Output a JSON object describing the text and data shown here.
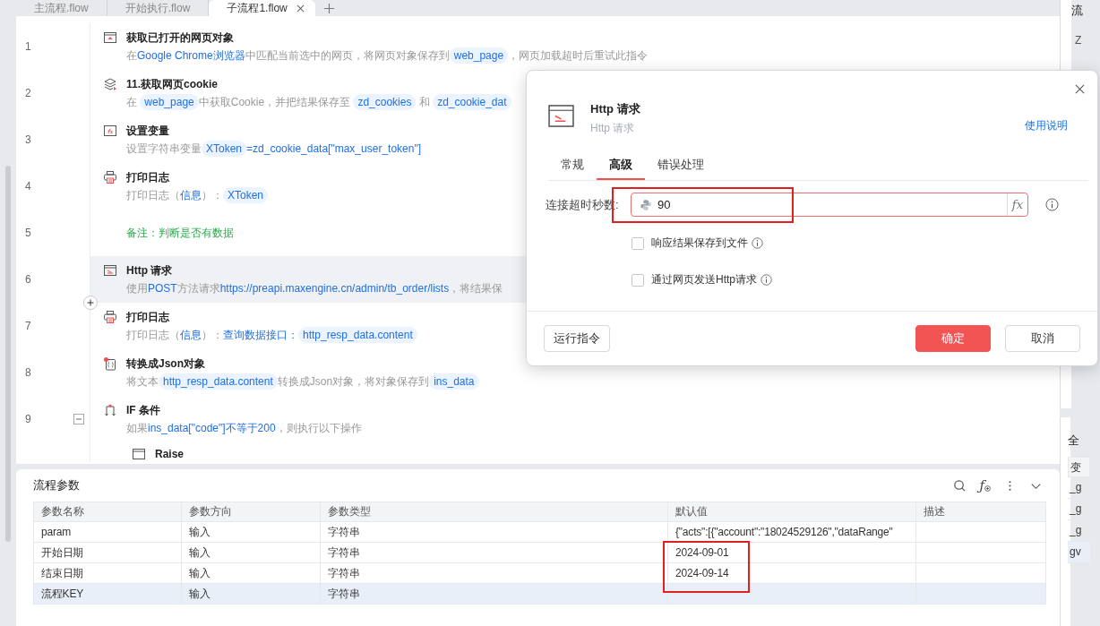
{
  "tabs": [
    {
      "label": "主流程.flow",
      "selected": false
    },
    {
      "label": "开始执行.flow",
      "selected": false
    },
    {
      "label": "子流程1.flow",
      "selected": true
    }
  ],
  "steps": [
    {
      "number": "1",
      "kind": "step",
      "selected": false,
      "title": "获取已打开的网页对象",
      "desc": [
        {
          "kind": "text",
          "text": "在"
        },
        {
          "kind": "link",
          "text": "Google Chrome浏览器"
        },
        {
          "kind": "text",
          "text": "中匹配当前选中的网页，将网页对象保存到"
        },
        {
          "kind": "var",
          "text": "web_page"
        },
        {
          "kind": "text",
          "text": "，网页加载超时后重试此指令"
        }
      ]
    },
    {
      "number": "2",
      "kind": "step",
      "selected": false,
      "title": "11.获取网页cookie",
      "desc": [
        {
          "kind": "text",
          "text": "在 "
        },
        {
          "kind": "var",
          "text": "web_page"
        },
        {
          "kind": "text",
          "text": "中获取Cookie，并把结果保存至 "
        },
        {
          "kind": "var",
          "text": "zd_cookies"
        },
        {
          "kind": "text",
          "text": " 和 "
        },
        {
          "kind": "var",
          "text": "zd_cookie_dat"
        }
      ]
    },
    {
      "number": "3",
      "kind": "step",
      "selected": false,
      "title": "设置变量",
      "desc": [
        {
          "kind": "text",
          "text": "设置字符串变量"
        },
        {
          "kind": "var",
          "text": "XToken"
        },
        {
          "kind": "link",
          "text": "=zd_cookie_data[\"max_user_token\"]"
        }
      ]
    },
    {
      "number": "4",
      "kind": "step",
      "selected": false,
      "title": "打印日志",
      "desc": [
        {
          "kind": "text",
          "text": "打印日志（"
        },
        {
          "kind": "link",
          "text": "信息"
        },
        {
          "kind": "text",
          "text": "）："
        },
        {
          "kind": "var",
          "text": "XToken"
        }
      ]
    },
    {
      "number": "5",
      "kind": "comment",
      "selected": false,
      "text": "备注：判断是否有数据"
    },
    {
      "number": "6",
      "kind": "step",
      "selected": true,
      "title": "Http 请求",
      "desc": [
        {
          "kind": "text",
          "text": "使用"
        },
        {
          "kind": "link",
          "text": "POST"
        },
        {
          "kind": "text",
          "text": "方法请求"
        },
        {
          "kind": "link",
          "text": "https://preapi.maxengine.cn/admin/tb_order/lists"
        },
        {
          "kind": "text",
          "text": "，将结果保"
        }
      ]
    },
    {
      "number": "7",
      "kind": "step",
      "selected": false,
      "insert_button": true,
      "title": "打印日志",
      "desc": [
        {
          "kind": "text",
          "text": "打印日志（"
        },
        {
          "kind": "link",
          "text": "信息"
        },
        {
          "kind": "text",
          "text": "）："
        },
        {
          "kind": "link",
          "text": "查询数据接口："
        },
        {
          "kind": "var",
          "text": "http_resp_data.content"
        }
      ]
    },
    {
      "number": "8",
      "kind": "step",
      "selected": false,
      "title": "转换成Json对象",
      "desc": [
        {
          "kind": "text",
          "text": "将文本"
        },
        {
          "kind": "var",
          "text": "http_resp_data.content"
        },
        {
          "kind": "text",
          "text": "转换成Json对象，将对象保存到"
        },
        {
          "kind": "var",
          "text": "ins_data"
        }
      ]
    },
    {
      "number": "9",
      "kind": "step",
      "selected": false,
      "expanded": true,
      "title": "IF 条件",
      "desc": [
        {
          "kind": "text",
          "text": "如果"
        },
        {
          "kind": "link",
          "text": "ins_data[\"code\"]不等于200"
        },
        {
          "kind": "text",
          "text": "，则执行以下操作"
        }
      ],
      "children": [
        {
          "kind": "step",
          "title": "Raise"
        }
      ]
    }
  ],
  "params": {
    "title": "流程参数",
    "function_button": "ƒ",
    "columns": [
      "参数名称",
      "参数方向",
      "参数类型",
      "默认值",
      "描述"
    ],
    "rows": [
      {
        "cells": [
          "param",
          "输入",
          "字符串",
          "{\"acts\":[{\"account\":\"18024529126\",\"dataRange\"",
          ""
        ],
        "selected": false
      },
      {
        "cells": [
          "开始日期",
          "输入",
          "字符串",
          "2024-09-01",
          ""
        ],
        "selected": false
      },
      {
        "cells": [
          "结束日期",
          "输入",
          "字符串",
          "2024-09-14",
          ""
        ],
        "selected": false
      },
      {
        "cells": [
          "流程KEY",
          "输入",
          "字符串",
          "",
          ""
        ],
        "selected": true
      }
    ]
  },
  "right_panel": {
    "title": "流",
    "tree_item": "Z",
    "lower_title": "全",
    "column": "变",
    "rows": [
      {
        "text": "_g",
        "selected": false
      },
      {
        "text": "_g",
        "selected": false
      },
      {
        "text": "_g",
        "selected": false
      },
      {
        "text": "gv",
        "selected": true
      }
    ]
  },
  "dialog": {
    "title": "Http 请求",
    "subtitle": "Http 请求",
    "help_link": "使用说明",
    "tabs": [
      {
        "label": "常规",
        "selected": false
      },
      {
        "label": "高级",
        "selected": true
      },
      {
        "label": "错误处理",
        "selected": false
      }
    ],
    "field": {
      "label": "连接超时秒数:",
      "value": "90",
      "formula_button": "fx"
    },
    "checkboxes": [
      {
        "label": "响应结果保存到文件",
        "checked": false
      },
      {
        "label": "通过网页发送Http请求",
        "checked": false
      }
    ],
    "buttons": [
      {
        "label": "运行指令",
        "kind": "default"
      },
      {
        "label": "确定",
        "kind": "primary"
      },
      {
        "label": "取消",
        "kind": "default"
      }
    ]
  }
}
